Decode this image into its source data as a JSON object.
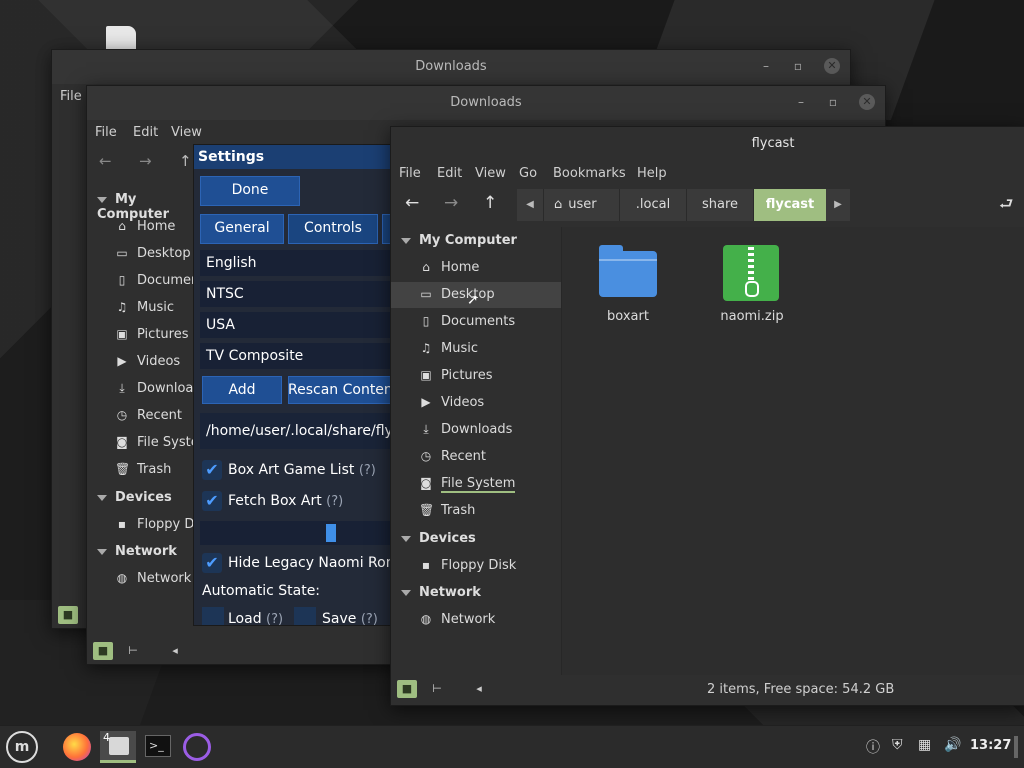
{
  "back_window": {
    "title": "Downloads",
    "menu": [
      "File"
    ]
  },
  "mid_window": {
    "title": "Downloads",
    "menu": [
      "File",
      "Edit",
      "View"
    ],
    "sidebar": {
      "my_computer": "My Computer",
      "items": [
        {
          "label": "Home",
          "icon": "home-icon"
        },
        {
          "label": "Desktop",
          "icon": "desktop-icon"
        },
        {
          "label": "Documents",
          "icon": "document-icon"
        },
        {
          "label": "Music",
          "icon": "music-icon"
        },
        {
          "label": "Pictures",
          "icon": "pictures-icon"
        },
        {
          "label": "Videos",
          "icon": "video-icon"
        },
        {
          "label": "Downloads",
          "icon": "download-icon"
        },
        {
          "label": "Recent",
          "icon": "recent-icon"
        },
        {
          "label": "File System",
          "icon": "drive-icon"
        },
        {
          "label": "Trash",
          "icon": "trash-icon"
        }
      ],
      "devices": "Devices",
      "device_items": [
        {
          "label": "Floppy Disk"
        }
      ],
      "network": "Network",
      "network_items": [
        {
          "label": "Network"
        }
      ]
    }
  },
  "settings": {
    "title": "Settings",
    "done": "Done",
    "tabs": [
      "General",
      "Controls"
    ],
    "language": "English",
    "broadcast": "NTSC",
    "region": "USA",
    "cable": "TV Composite",
    "add": "Add",
    "rescan": "Rescan Content",
    "content_path": "/home/user/.local/share/flycast",
    "box_art_list": "Box Art Game List",
    "fetch_box_art": "Fetch Box Art",
    "hide_legacy": "Hide Legacy Naomi Roms",
    "auto_state": "Automatic State:",
    "load": "Load",
    "save": "Save",
    "hint": "(?)",
    "slider_value": 0.7
  },
  "front_window": {
    "title": "flycast",
    "menu": [
      "File",
      "Edit",
      "View",
      "Go",
      "Bookmarks",
      "Help"
    ],
    "breadcrumb": [
      "user",
      ".local",
      "share",
      "flycast"
    ],
    "sidebar": {
      "my_computer": "My Computer",
      "items": [
        {
          "label": "Home"
        },
        {
          "label": "Desktop"
        },
        {
          "label": "Documents"
        },
        {
          "label": "Music"
        },
        {
          "label": "Pictures"
        },
        {
          "label": "Videos"
        },
        {
          "label": "Downloads"
        },
        {
          "label": "Recent"
        },
        {
          "label": "File System"
        },
        {
          "label": "Trash"
        }
      ],
      "devices": "Devices",
      "device_items": [
        {
          "label": "Floppy Disk"
        }
      ],
      "network": "Network",
      "network_items": [
        {
          "label": "Network"
        }
      ]
    },
    "files": [
      {
        "name": "boxart",
        "type": "folder"
      },
      {
        "name": "naomi.zip",
        "type": "zip"
      }
    ],
    "status": "2 items, Free space: 54.2 GB",
    "accent": "#9fbe81",
    "folder_color": "#4a8fe0",
    "zip_color": "#44b04a"
  },
  "taskbar": {
    "clock": "13:27",
    "badge": "4"
  }
}
